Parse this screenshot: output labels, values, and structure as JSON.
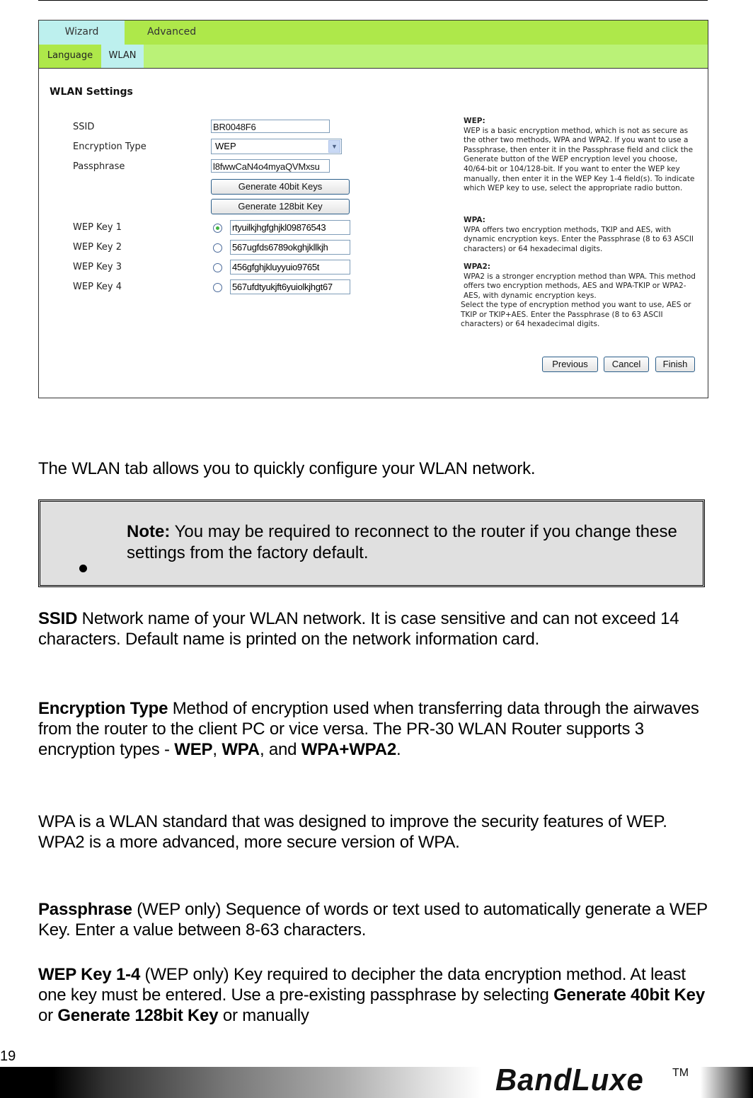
{
  "screenshot": {
    "tabs_primary": [
      "Wizard",
      "Advanced"
    ],
    "tabs_secondary": [
      "Language",
      "WLAN"
    ],
    "active_primary": "Wizard",
    "active_secondary": "WLAN",
    "section_title": "WLAN Settings",
    "labels": {
      "ssid": "SSID",
      "encryption_type": "Encryption Type",
      "passphrase": "Passphrase",
      "wep_keys": [
        "WEP Key 1",
        "WEP Key 2",
        "WEP Key 3",
        "WEP Key 4"
      ]
    },
    "values": {
      "ssid": "BR0048F6",
      "encryption_type": "WEP",
      "passphrase": "l8fwwCaN4o4myaQVMxsu",
      "wep_keys": [
        "rtyuilkjhgfghjkl09876543",
        "567ugfds6789okghjkllkjh",
        "456gfghjkluyyuio9765t",
        "567ufdtyukjft6yuiolkjhgt67"
      ],
      "selected_key": 1
    },
    "buttons": {
      "gen40": "Generate 40bit Keys",
      "gen128": "Generate 128bit Key",
      "previous": "Previous",
      "cancel": "Cancel",
      "finish": "Finish"
    },
    "help": {
      "wep_title": "WEP:",
      "wep_text": "WEP is a basic encryption method, which is not as secure as the other two methods, WPA and WPA2. If you want to use a Passphrase, then enter it in the Passphrase field and click the Generate button of the WEP encryption level you choose, 40/64-bit or 104/128-bit. If you want to enter the WEP key manually, then enter it in the WEP Key 1-4 field(s). To indicate which WEP key to use, select the appropriate radio button.",
      "wpa_title": "WPA:",
      "wpa_text": "WPA offers two encryption methods, TKIP and AES, with dynamic encryption keys. Enter the Passphrase (8 to 63 ASCII characters) or 64 hexadecimal digits.",
      "wpa2_title": "WPA2:",
      "wpa2_text": "WPA2 is a stronger encryption method than WPA. This method offers two encryption methods, AES and WPA-TKIP or WPA2-AES, with dynamic encryption keys.",
      "wpa2_text2": "Select the type of encryption method you want to use, AES or TKIP or TKIP+AES. Enter the Passphrase (8 to 63 ASCII characters) or 64 hexadecimal digits."
    }
  },
  "doc": {
    "intro": "The WLAN tab allows you to quickly configure your WLAN network.",
    "note_label": "Note:",
    "note_text": " You may be required to reconnect to the router if you change these settings from the factory default.",
    "ssid_term": "SSID",
    "ssid_desc": " Network name of your WLAN network. It is case sensitive and can not exceed 14 characters. Default name is printed on the network information card.",
    "enc_term": "Encryption Type",
    "enc_desc": " Method of encryption used when transferring data through the airwaves from the router to the client PC or vice versa. The PR-30 WLAN Router supports 3 encryption types - ",
    "enc_wep": "WEP",
    "enc_sep1": ", ",
    "enc_wpa": "WPA",
    "enc_sep2": ", and ",
    "enc_wpa2": "WPA+WPA2",
    "enc_end": ".",
    "wpa_para": "WPA is a WLAN standard that was designed to improve the security features of WEP. WPA2 is a more advanced, more secure version of WPA.",
    "pass_term": "Passphrase",
    "pass_desc": " (WEP only) Sequence of words or text used to automatically generate a WEP Key. Enter a value between 8-63 characters.",
    "wepkey_term": "WEP Key 1-4",
    "wepkey_desc": " (WEP only) Key required to decipher the data encryption method. At least one key must be entered. Use a pre-existing passphrase by selecting ",
    "wepkey_gen40": "Generate 40bit Key",
    "wepkey_or": " or ",
    "wepkey_gen128": "Generate 128bit Key",
    "wepkey_end": " or manually"
  },
  "footer": {
    "page_number": "19",
    "brand": "BandLuxe",
    "trademark": "TM"
  }
}
